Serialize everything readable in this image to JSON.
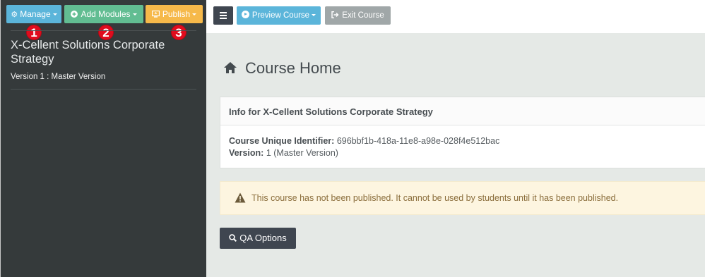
{
  "sidebar": {
    "toolbar": {
      "manage_label": "Manage",
      "add_modules_label": "Add Modules",
      "publish_label": "Publish"
    },
    "badges": [
      "1",
      "2",
      "3"
    ],
    "course_name": "X-Cellent Solutions Corporate Strategy",
    "version_line": "Version 1 : Master Version"
  },
  "topbar": {
    "preview_label": "Preview Course",
    "exit_label": "Exit Course"
  },
  "main": {
    "page_title": "Course Home",
    "info": {
      "header": "Info for X-Cellent Solutions Corporate Strategy",
      "uid_label": "Course Unique Identifier:",
      "uid_value": "696bbf1b-418a-11e8-a98e-028f4e512bac",
      "version_label": "Version:",
      "version_value": "1 (Master Version)"
    },
    "warning": "This course has not been published. It cannot be used by students until it has been published.",
    "qa_label": "QA Options"
  },
  "colors": {
    "sidebar_bg": "#353a3b",
    "manage": "#5bb5da",
    "add_modules": "#62bd92",
    "publish": "#f6b94a",
    "badge": "#e00c1e",
    "dark_button": "#3f4650",
    "exit": "#a0a7a8",
    "warning_bg": "#fdf5e0"
  },
  "icons": [
    "gear-icon",
    "plus-circle-icon",
    "publish-icon",
    "hamburger-icon",
    "play-circle-icon",
    "exit-icon",
    "home-icon",
    "warning-icon",
    "search-icon"
  ]
}
